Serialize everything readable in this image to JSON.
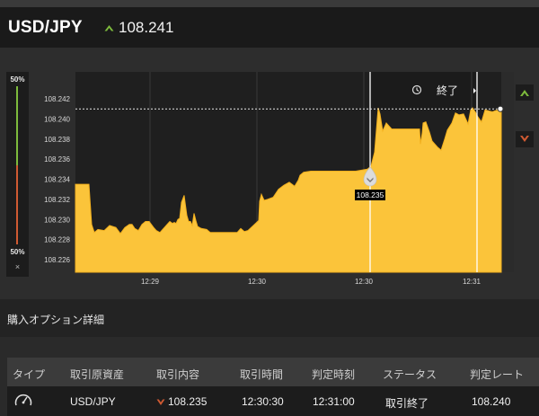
{
  "header": {
    "pair": "USD/JPY",
    "price": "108.241",
    "direction_icon": "chevron-up-icon",
    "up_color": "#7dbb3c"
  },
  "gauge": {
    "top_label": "50%",
    "bottom_label": "50%",
    "close_label": "×",
    "green_color": "#7dbb3c",
    "red_color": "#d05a32"
  },
  "chart": {
    "end_label": "終了",
    "end_icon": "clock-icon",
    "entry_marker_icon": "chevron-down-icon",
    "high_button_icon": "chevron-up-icon",
    "low_button_icon": "chevron-down-icon"
  },
  "chart_data": {
    "type": "area",
    "fill_color": "#fbc43a",
    "line_color": "#f2b01f",
    "ylim": [
      108.2245,
      108.2445
    ],
    "y_ticks": [
      "108.242",
      "108.240",
      "108.238",
      "108.236",
      "108.234",
      "108.232",
      "108.230",
      "108.228",
      "108.226"
    ],
    "x_ticks": [
      "12:29",
      "12:30",
      "12:30",
      "12:31"
    ],
    "current_price": 108.241,
    "entry_price": 108.235,
    "entry_label": "108.235",
    "points": [
      [
        0,
        108.2335
      ],
      [
        15,
        108.2335
      ],
      [
        18,
        108.2295
      ],
      [
        21,
        108.2287
      ],
      [
        25,
        108.229
      ],
      [
        32,
        108.2289
      ],
      [
        38,
        108.2294
      ],
      [
        45,
        108.2292
      ],
      [
        50,
        108.2286
      ],
      [
        55,
        108.2292
      ],
      [
        60,
        108.2295
      ],
      [
        63,
        108.2295
      ],
      [
        66,
        108.2291
      ],
      [
        70,
        108.2289
      ],
      [
        74,
        108.2295
      ],
      [
        78,
        108.2298
      ],
      [
        82,
        108.2298
      ],
      [
        87,
        108.2292
      ],
      [
        90,
        108.2289
      ],
      [
        94,
        108.2287
      ],
      [
        98,
        108.2291
      ],
      [
        102,
        108.2295
      ],
      [
        105,
        108.2298
      ],
      [
        108,
        108.2296
      ],
      [
        110,
        108.2297
      ],
      [
        112,
        108.2296
      ],
      [
        114,
        108.23
      ],
      [
        116,
        108.2301
      ],
      [
        118,
        108.2317
      ],
      [
        121,
        108.2324
      ],
      [
        122,
        108.2317
      ],
      [
        124,
        108.2304
      ],
      [
        126,
        108.2298
      ],
      [
        128,
        108.2298
      ],
      [
        130,
        108.2294
      ],
      [
        131,
        108.23
      ],
      [
        132,
        108.2306
      ],
      [
        134,
        108.2299
      ],
      [
        136,
        108.2293
      ],
      [
        140,
        108.2291
      ],
      [
        146,
        108.229
      ],
      [
        150,
        108.2287
      ],
      [
        165,
        108.2287
      ],
      [
        180,
        108.2287
      ],
      [
        184,
        108.2291
      ],
      [
        188,
        108.2288
      ],
      [
        192,
        108.2289
      ],
      [
        204,
        108.2299
      ],
      [
        205,
        108.2318
      ],
      [
        207,
        108.2325
      ],
      [
        210,
        108.2319
      ],
      [
        214,
        108.232
      ],
      [
        220,
        108.2322
      ],
      [
        226,
        108.233
      ],
      [
        232,
        108.2334
      ],
      [
        238,
        108.2337
      ],
      [
        244,
        108.2333
      ],
      [
        248,
        108.2339
      ],
      [
        250,
        108.2344
      ],
      [
        254,
        108.2347
      ],
      [
        262,
        108.2348
      ],
      [
        272,
        108.2348
      ],
      [
        288,
        108.2348
      ],
      [
        300,
        108.2348
      ],
      [
        312,
        108.2348
      ],
      [
        325,
        108.235
      ],
      [
        329,
        108.2353
      ],
      [
        333,
        108.2367
      ],
      [
        337,
        108.2411
      ],
      [
        339,
        108.2405
      ],
      [
        342,
        108.2388
      ],
      [
        346,
        108.2396
      ],
      [
        352,
        108.239
      ],
      [
        360,
        108.239
      ],
      [
        368,
        108.239
      ],
      [
        376,
        108.239
      ],
      [
        383,
        108.239
      ],
      [
        384,
        108.2375
      ],
      [
        386,
        108.2386
      ],
      [
        387,
        108.2396
      ],
      [
        390,
        108.2397
      ],
      [
        394,
        108.2387
      ],
      [
        397,
        108.2378
      ],
      [
        403,
        108.2372
      ],
      [
        407,
        108.2369
      ],
      [
        411,
        108.238
      ],
      [
        414,
        108.2389
      ],
      [
        419,
        108.2396
      ],
      [
        423,
        108.2406
      ],
      [
        427,
        108.2404
      ],
      [
        432,
        108.2405
      ],
      [
        437,
        108.2395
      ],
      [
        440,
        108.2409
      ],
      [
        442,
        108.2411
      ],
      [
        445,
        108.2407
      ],
      [
        448,
        108.2402
      ],
      [
        452,
        108.2397
      ],
      [
        456,
        108.2409
      ],
      [
        464,
        108.2407
      ],
      [
        470,
        108.2409
      ],
      [
        474,
        108.241
      ]
    ]
  },
  "details": {
    "section_title": "購入オプション詳細",
    "columns": [
      "タイプ",
      "取引原資産",
      "取引内容",
      "取引時間",
      "判定時刻",
      "ステータス",
      "判定レート"
    ],
    "row": {
      "type_icon": "speedometer-icon",
      "asset": "USD/JPY",
      "trade_direction_icon": "chevron-down-icon",
      "trade_price": "108.235",
      "trade_time": "12:30:30",
      "judge_time": "12:31:00",
      "status": "取引終了",
      "judge_rate": "108.240"
    }
  }
}
